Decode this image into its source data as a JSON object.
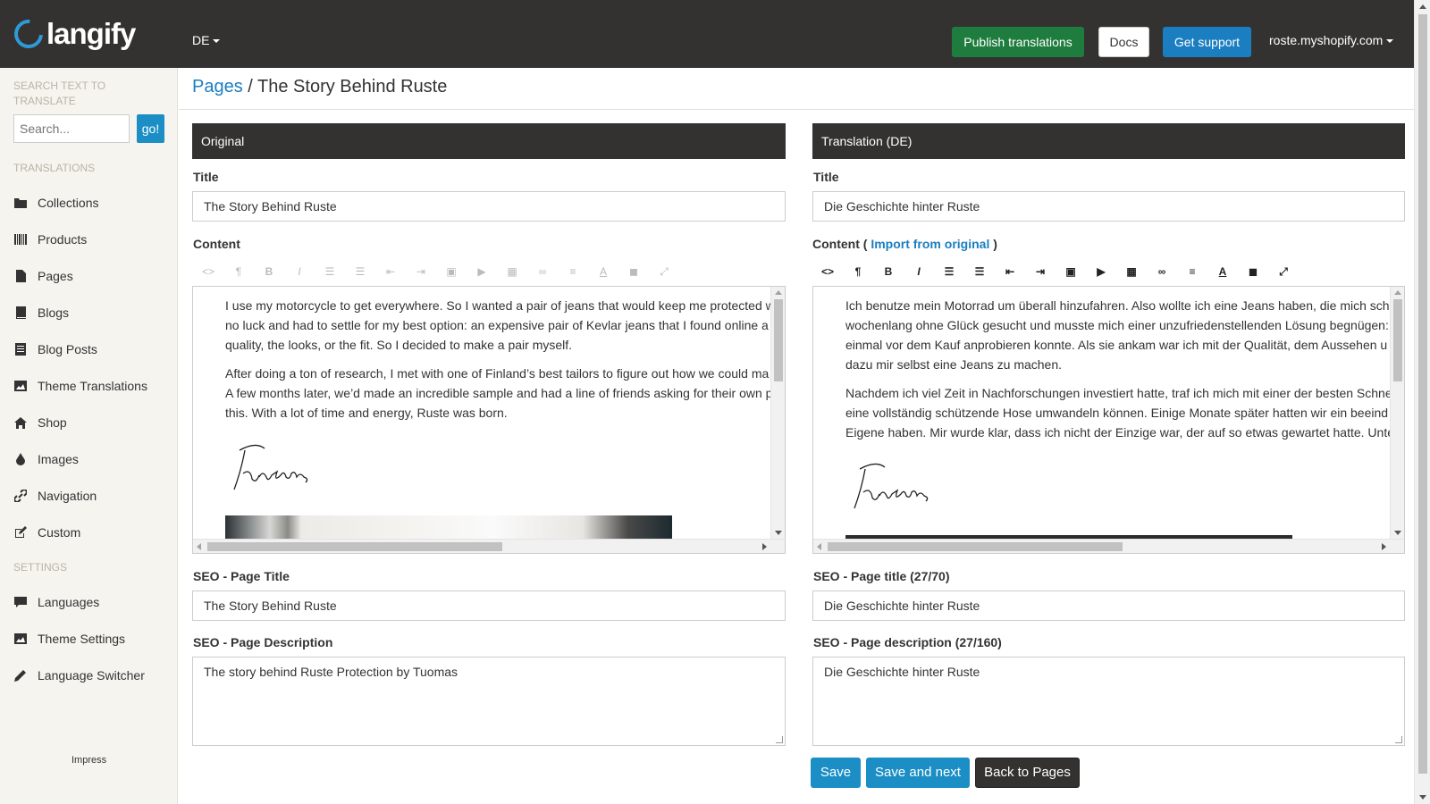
{
  "app": {
    "logo_text": "langify",
    "language": "DE",
    "shop": "roste.myshopify.com"
  },
  "header": {
    "publish_label": "Publish translations",
    "docs_label": "Docs",
    "support_label": "Get support"
  },
  "sidebar": {
    "search_heading": "SEARCH TEXT TO TRANSLATE",
    "search_placeholder": "Search...",
    "go_label": "go!",
    "translations_heading": "TRANSLATIONS",
    "translation_items": [
      {
        "label": "Collections",
        "icon": "folder-icon"
      },
      {
        "label": "Products",
        "icon": "barcode-icon"
      },
      {
        "label": "Pages",
        "icon": "file-icon"
      },
      {
        "label": "Blogs",
        "icon": "book-icon"
      },
      {
        "label": "Blog Posts",
        "icon": "list-icon"
      },
      {
        "label": "Theme Translations",
        "icon": "picture-icon"
      },
      {
        "label": "Shop",
        "icon": "home-icon"
      },
      {
        "label": "Images",
        "icon": "tint-icon"
      },
      {
        "label": "Navigation",
        "icon": "link-icon"
      },
      {
        "label": "Custom",
        "icon": "edit-icon"
      }
    ],
    "settings_heading": "SETTINGS",
    "settings_items": [
      {
        "label": "Languages",
        "icon": "comment-icon"
      },
      {
        "label": "Theme Settings",
        "icon": "picture-icon"
      },
      {
        "label": "Language Switcher",
        "icon": "pencil-icon"
      }
    ],
    "impress_label": "Impress"
  },
  "breadcrumb": {
    "parent": "Pages",
    "separator": " / ",
    "current": "The Story Behind Ruste"
  },
  "original": {
    "header": "Original",
    "title_label": "Title",
    "title_value": "The Story Behind Ruste",
    "content_label": "Content",
    "paragraphs": [
      "I use my motorcycle to get everywhere. So I wanted a pair of jeans that would keep me protected w",
      "no luck and had to settle for my best option: an expensive pair of Kevlar jeans that I found online a",
      "quality, the looks, or the fit. So I decided to make a pair myself.",
      "After doing a ton of research, I met with one of Finland’s best tailors to figure out how we could ma",
      "A few months later, we’d made an incredible sample and had a line of friends asking for their own p",
      "this. With a lot of time and energy, Ruste was born."
    ],
    "signature": "Tuomas",
    "seo_title_label": "SEO - Page Title",
    "seo_title_value": "The Story Behind Ruste",
    "seo_desc_label": "SEO - Page Description",
    "seo_desc_value": "The story behind Ruste Protection by Tuomas"
  },
  "translation": {
    "header": "Translation (DE)",
    "title_label": "Title",
    "title_value": "Die Geschichte hinter Ruste",
    "content_label": "Content (",
    "import_link": "Import from original",
    "content_label_end": ")",
    "paragraphs": [
      "Ich benutze mein Motorrad um überall hinzufahren. Also wollte ich eine Jeans haben, die mich sch",
      "wochenlang ohne Glück gesucht und musste mich einer unzufriedenstellenden Lösung begnügen:",
      "einmal vor dem Kauf anprobieren konnte. Als sie ankam war ich mit der Qualität, dem Aussehen u",
      "dazu mir selbst eine Jeans zu machen.",
      "Nachdem ich viel Zeit in Nachforschungen investiert hatte, traf ich mich mit einer der besten Schne",
      "eine vollständig schützende Hose umwandeln können. Einige Monate später hatten wir ein beeind",
      "Eigene haben. Mir wurde klar, dass ich nicht der Einzige war, der auf so etwas gewartet hatte. Unte"
    ],
    "signature": "Tuomas",
    "seo_title_label": "SEO - Page title (27/70)",
    "seo_title_value": "Die Geschichte hinter Ruste",
    "seo_desc_label": "SEO - Page description (27/160)",
    "seo_desc_value": "Die Geschichte hinter Ruste"
  },
  "actions": {
    "save_label": "Save",
    "save_next_label": "Save and next",
    "back_label": "Back to Pages"
  },
  "toolbar_icons": [
    "code-icon",
    "paragraph-icon",
    "bold-icon",
    "italic-icon",
    "unordered-list-icon",
    "ordered-list-icon",
    "outdent-icon",
    "indent-icon",
    "image-icon",
    "video-icon",
    "table-icon",
    "link-icon",
    "align-icon",
    "font-color-icon",
    "background-color-icon",
    "fullscreen-icon"
  ],
  "colors": {
    "topbar": "#333231",
    "publish": "#1f7c3f",
    "support": "#1b7ec0",
    "save": "#1b8ec5",
    "sidebar": "#f6f4ef"
  }
}
